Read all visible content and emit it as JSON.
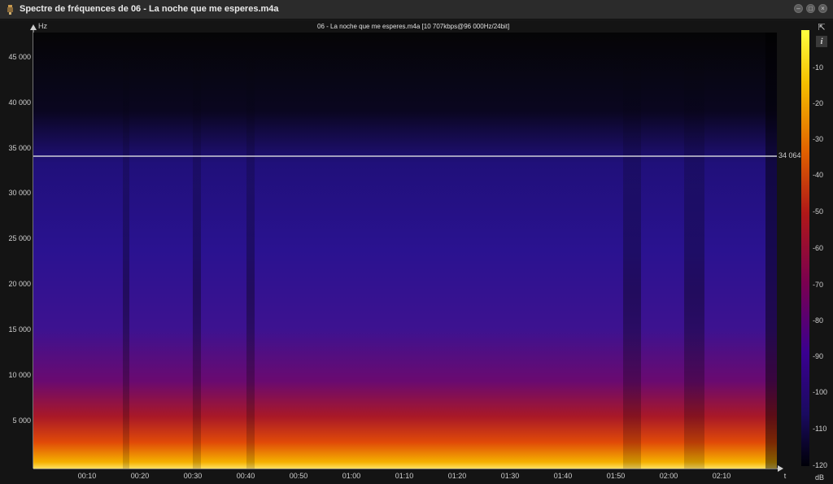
{
  "window": {
    "title": "Spectre de fréquences de 06 - La noche que me esperes.m4a"
  },
  "plot": {
    "title": "06 - La noche que me esperes.m4a [10 707kbps@96 000Hz/24bit]",
    "y_unit": "Hz",
    "x_unit": "t",
    "y_ticks": [
      "45 000",
      "40 000",
      "35 000",
      "30 000",
      "25 000",
      "20 000",
      "15 000",
      "10 000",
      "5 000"
    ],
    "x_ticks": [
      "00:10",
      "00:20",
      "00:30",
      "00:40",
      "00:50",
      "01:00",
      "01:10",
      "01:20",
      "01:30",
      "01:40",
      "01:50",
      "02:00",
      "02:10"
    ],
    "cutoff_label": "34 064"
  },
  "colorbar": {
    "unit": "dB",
    "ticks": [
      "-10",
      "-20",
      "-30",
      "-40",
      "-50",
      "-60",
      "-70",
      "-80",
      "-90",
      "-100",
      "-110",
      "-120"
    ],
    "colors": [
      "#ffff40",
      "#f5c000",
      "#e06000",
      "#b01818",
      "#7a0050",
      "#3a0090",
      "#1a0a60",
      "#000008"
    ]
  },
  "chart_data": {
    "type": "heatmap",
    "title": "06 - La noche que me esperes.m4a [10 707kbps@96 000Hz/24bit]",
    "ylabel": "Hz",
    "xlabel": "t",
    "ylim": [
      0,
      48000
    ],
    "cutoff_hz": 34064,
    "colorbar_range_db": [
      -120,
      0
    ]
  },
  "buttons": {
    "export_icon": "export-icon",
    "info_icon": "info-icon"
  }
}
